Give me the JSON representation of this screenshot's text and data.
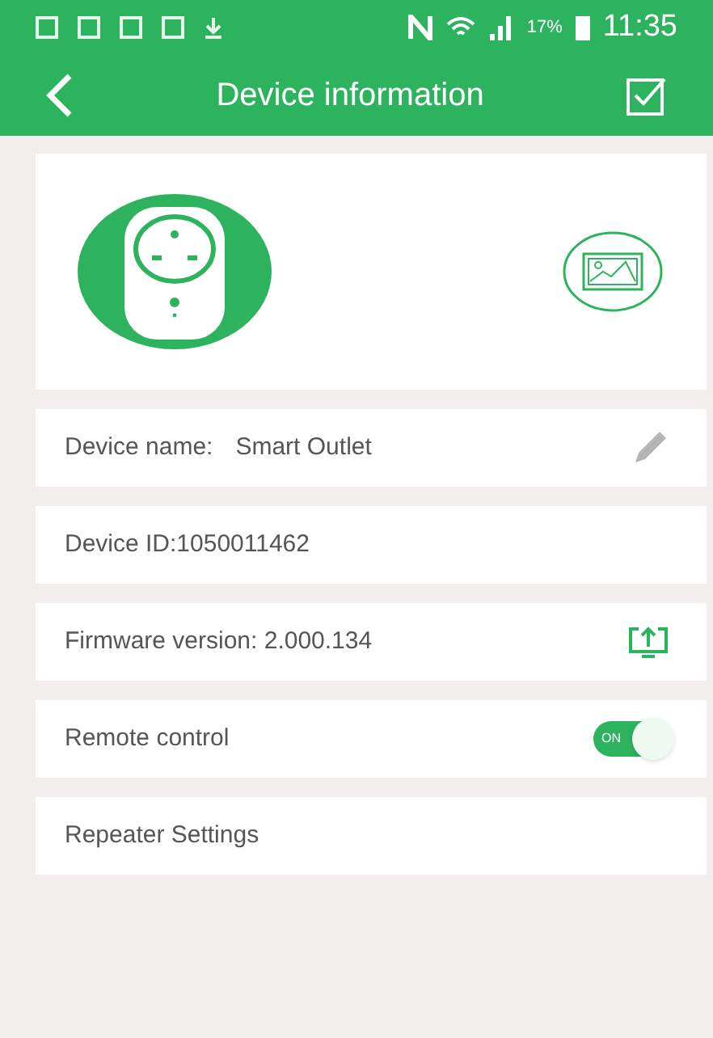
{
  "status_bar": {
    "battery": "17%",
    "time": "11:35"
  },
  "header": {
    "title": "Device information"
  },
  "rows": [
    {
      "kind": "name",
      "label": "Device name:",
      "value": "Smart Outlet"
    },
    {
      "kind": "text",
      "label": "Device ID:1050011462"
    },
    {
      "kind": "firmware",
      "label": "Firmware version: 2.000.134"
    },
    {
      "kind": "toggle",
      "label": "Remote control",
      "on": true,
      "toggle_text": "ON"
    },
    {
      "kind": "text",
      "label": "Repeater Settings"
    }
  ]
}
